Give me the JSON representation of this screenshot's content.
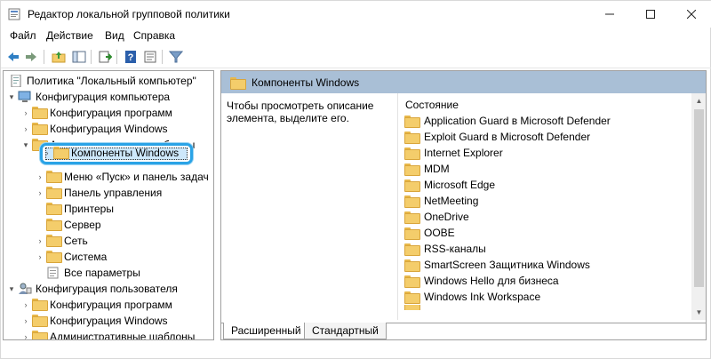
{
  "window": {
    "title": "Редактор локальной групповой политики"
  },
  "menu": [
    "Файл",
    "Действие",
    "Вид",
    "Справка"
  ],
  "toolbar": [
    "back-icon",
    "forward-icon",
    "up-folder-icon",
    "show-hide-tree-icon",
    "export-list-icon",
    "help-icon",
    "properties-icon",
    "filter-icon"
  ],
  "tree": {
    "root": "Политика \"Локальный компьютер\"",
    "computer_config": "Конфигурация компьютера",
    "cc_programs": "Конфигурация программ",
    "cc_windows": "Конфигурация Windows",
    "cc_admin": "Административные шаблоны",
    "windows_components": "Компоненты Windows",
    "start_menu": "Меню «Пуск» и панель задач",
    "control_panel": "Панель управления",
    "printers": "Принтеры",
    "server": "Сервер",
    "network": "Сеть",
    "system": "Система",
    "all_settings": "Все параметры",
    "user_config": "Конфигурация пользователя",
    "uc_programs": "Конфигурация программ",
    "uc_windows": "Конфигурация Windows",
    "uc_admin": "Административные шаблоны"
  },
  "details": {
    "header": "Компоненты Windows",
    "description": "Чтобы просмотреть описание элемента, выделите его.",
    "column": "Состояние",
    "items": [
      "Application Guard в Microsoft Defender",
      "Exploit Guard в Microsoft Defender",
      "Internet Explorer",
      "MDM",
      "Microsoft Edge",
      "NetMeeting",
      "OneDrive",
      "OOBE",
      "RSS-каналы",
      "SmartScreen Защитника Windows",
      "Windows Hello для бизнеса",
      "Windows Ink Workspace"
    ]
  },
  "tabs": [
    "Расширенный",
    "Стандартный"
  ],
  "colors": {
    "header_bg": "#a9bfd6",
    "selection_ring": "#2aa3e6",
    "folder": "#f4cd6b"
  }
}
